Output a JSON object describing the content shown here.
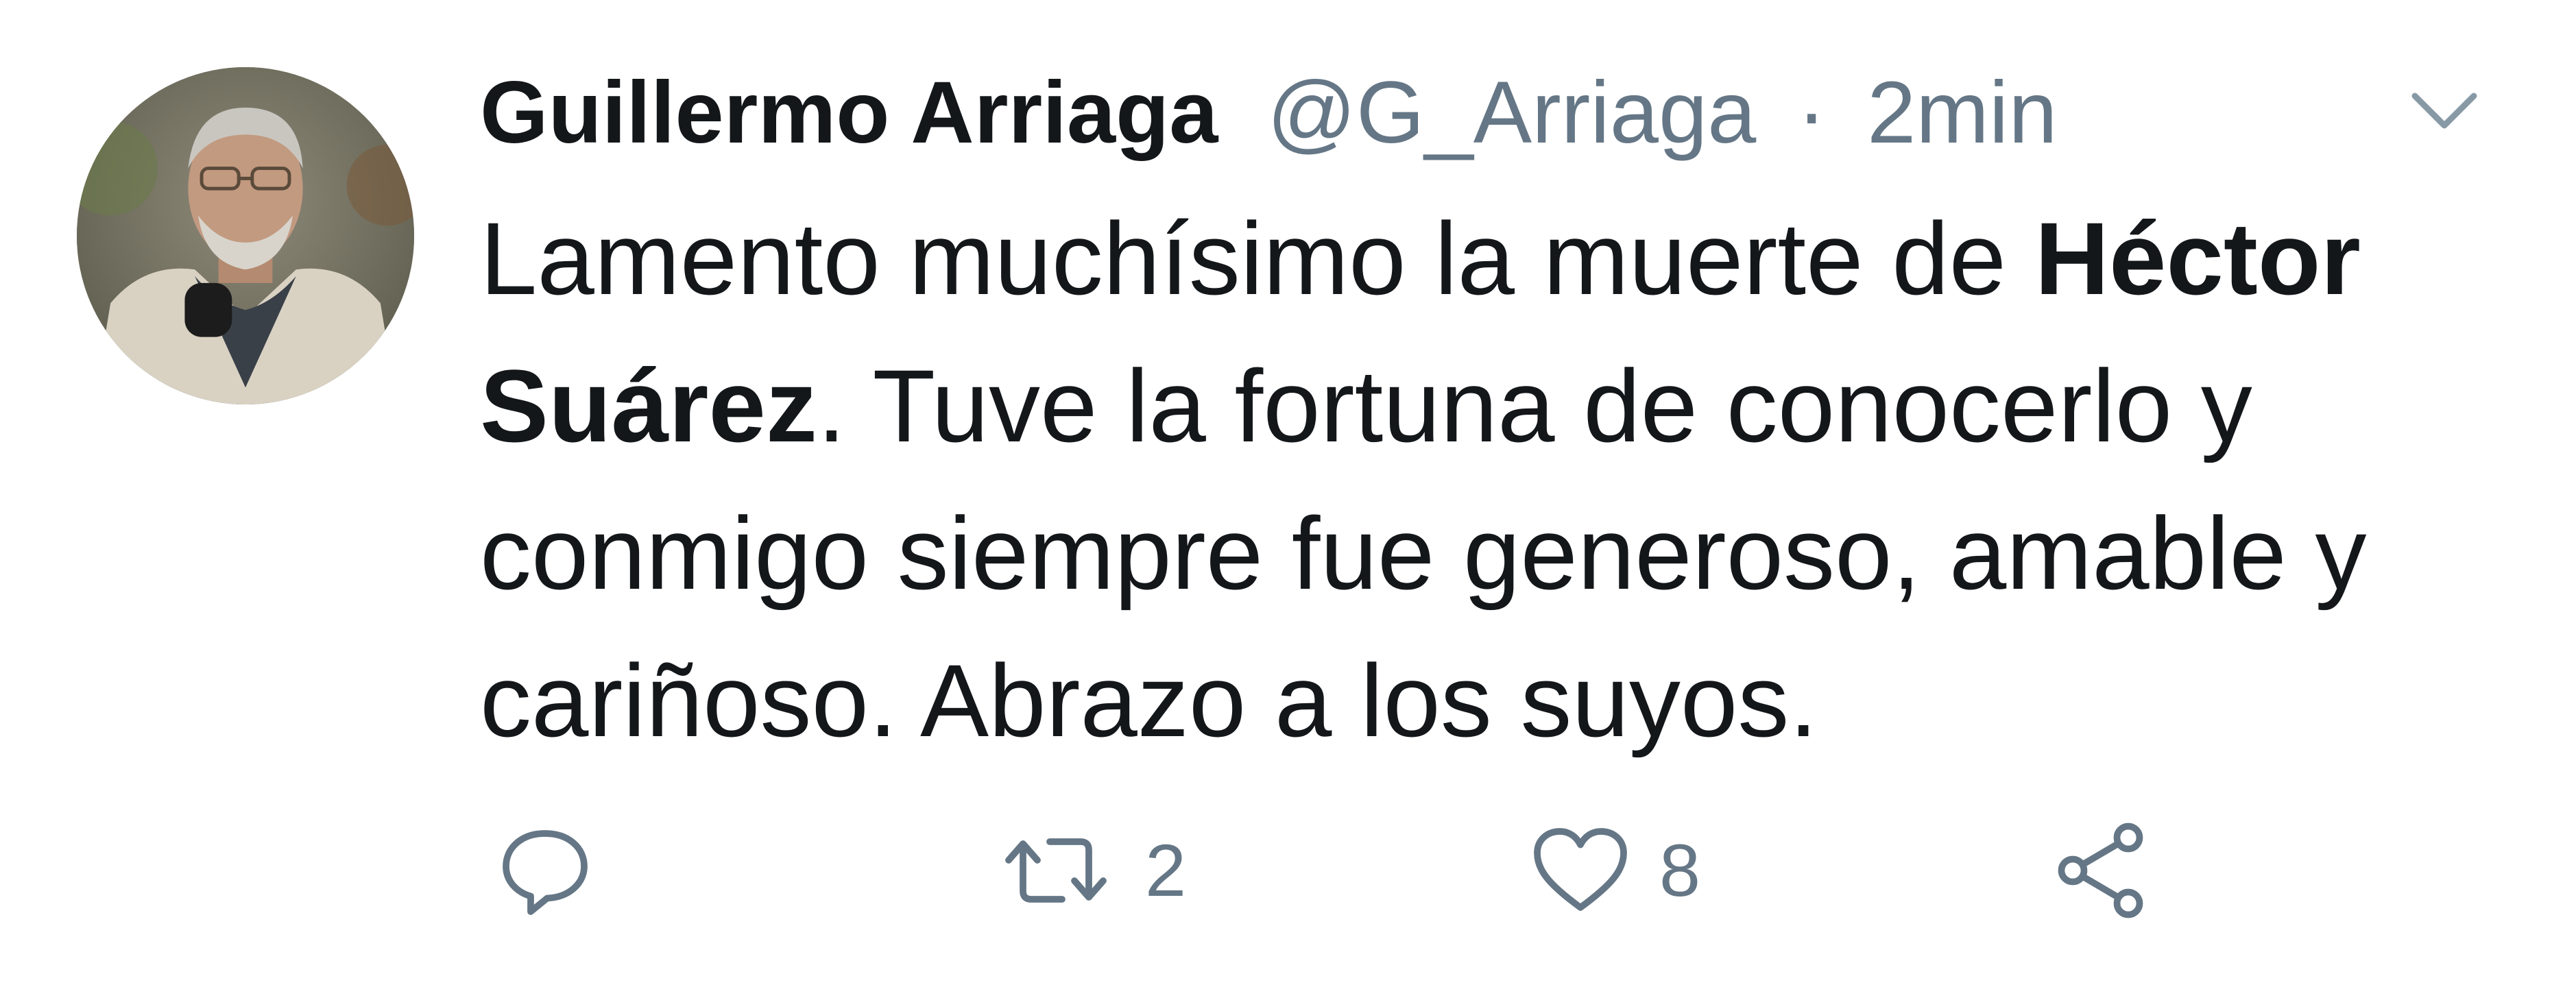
{
  "tweet": {
    "author_name": "Guillermo Arriaga",
    "handle": "@G_Arriaga",
    "separator": "·",
    "time": "2min",
    "text_part1": "Lamento muchísimo la muerte de ",
    "text_bold": "Héctor Suárez",
    "text_part2": ". Tuve la fortuna de conocerlo y conmigo siempre fue generoso, amable y cariñoso. Abrazo a los suyos."
  },
  "actions": {
    "reply_icon": "reply-icon",
    "retweet_icon": "retweet-icon",
    "retweet_count": "2",
    "like_icon": "heart-icon",
    "like_count": "8",
    "share_icon": "share-icon"
  },
  "colors": {
    "text": "#14171a",
    "secondary": "#657786",
    "icon": "#657786",
    "background": "#ffffff"
  }
}
